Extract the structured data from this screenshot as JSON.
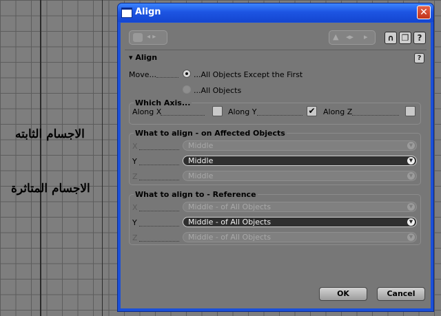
{
  "background": {
    "labels": [
      "الاجسام الثابته",
      "الاجسام المتاثرة"
    ]
  },
  "window": {
    "title": "Align",
    "close_glyph": "✕"
  },
  "toolbar": {
    "icons": [
      "wrench-icon",
      "arrows-icon",
      "magnet-icon",
      "copy-icon",
      "help-icon"
    ],
    "help_glyph": "?",
    "magnet_glyph": "∩",
    "copy_glyph": "❐"
  },
  "rollout": {
    "title": "Align",
    "collapse_glyph": "▾",
    "help_glyph": "?"
  },
  "move": {
    "label": "Move...",
    "options": [
      {
        "label": "...All Objects Except the First",
        "selected": true
      },
      {
        "label": "...All Objects",
        "selected": false
      }
    ]
  },
  "axis_group": {
    "title": "Which Axis...",
    "axes": [
      {
        "label": "Along X",
        "checked": false
      },
      {
        "label": "Along Y",
        "checked": true
      },
      {
        "label": "Along Z",
        "checked": false
      }
    ],
    "check_glyph": "✔"
  },
  "affected_group": {
    "title": "What to align - on Affected Objects",
    "rows": [
      {
        "axis": "X",
        "value": "Middle",
        "active": false
      },
      {
        "axis": "Y",
        "value": "Middle",
        "active": true
      },
      {
        "axis": "Z",
        "value": "Middle",
        "active": false
      }
    ]
  },
  "reference_group": {
    "title": "What to align to - Reference",
    "rows": [
      {
        "axis": "X",
        "value": "Middle  - of All Objects",
        "active": false
      },
      {
        "axis": "Y",
        "value": "Middle  - of All Objects",
        "active": true
      },
      {
        "axis": "Z",
        "value": "Middle  - of All Objects",
        "active": false
      }
    ]
  },
  "dropdown_glyph": "▼",
  "buttons": {
    "ok": "OK",
    "cancel": "Cancel"
  },
  "colors": {
    "titlebar": "#1d55e3",
    "panel": "#777777",
    "close": "#c2331a"
  }
}
